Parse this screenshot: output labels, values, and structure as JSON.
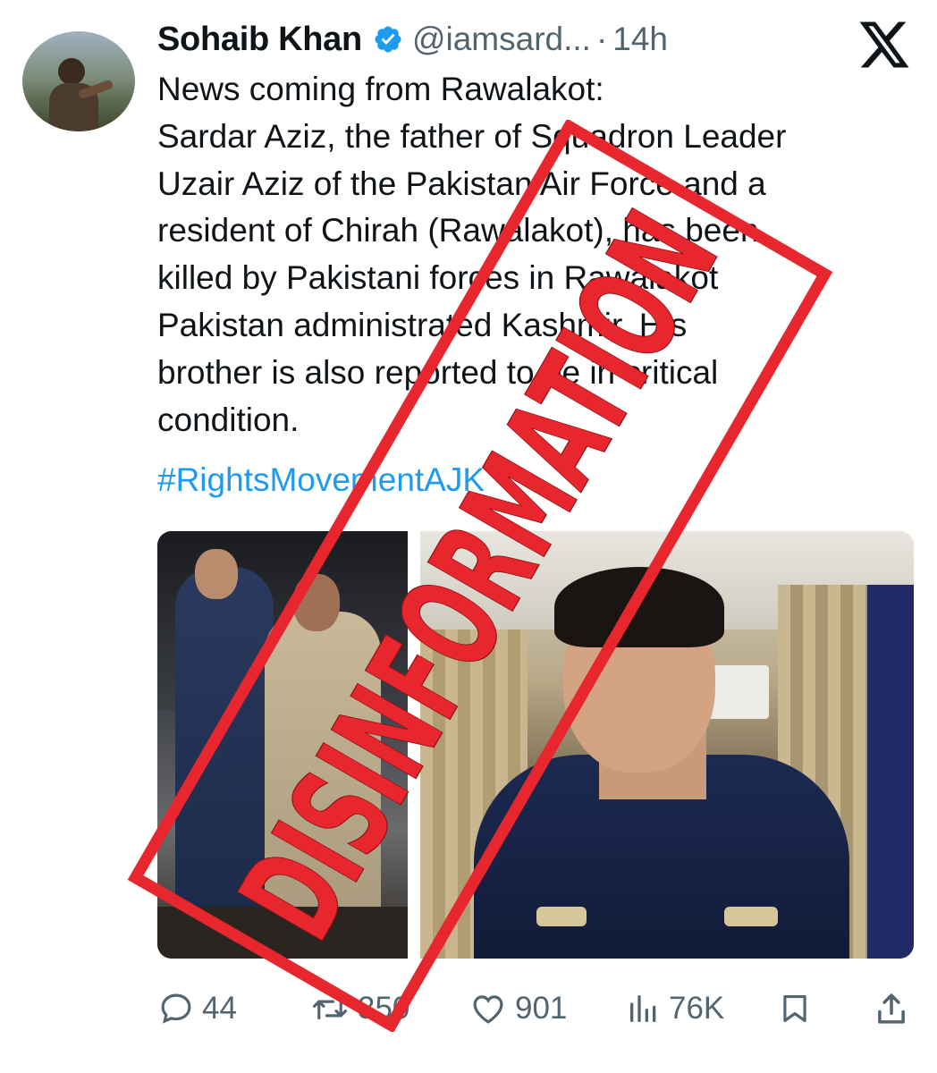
{
  "author": {
    "name": "Sohaib Khan",
    "handle": "@iamsard...",
    "separator": "·",
    "time": "14h"
  },
  "tweet": {
    "lines": [
      "News coming from Rawalakot:",
      "Sardar Aziz, the father of Squadron Leader",
      "Uzair Aziz of the Pakistan Air Force and a",
      "resident of Chirah (Rawalakot), has been",
      "killed by Pakistani forces in Rawalakot",
      "Pakistan administrated Kashmir. His",
      "brother is also reported to be in critical",
      "condition."
    ],
    "hashtag": "#RightsMovementAJK"
  },
  "stats": {
    "replies": "44",
    "reposts": "350",
    "likes": "901",
    "views": "76K"
  },
  "stamp": {
    "text": "DISINFORMATION",
    "color": "#e8262e"
  },
  "icons": {
    "verified": "verified-badge-icon",
    "platform": "x-logo-icon",
    "reply": "reply-icon",
    "repost": "repost-icon",
    "like": "heart-icon",
    "views": "views-chart-icon",
    "bookmark": "bookmark-icon",
    "share": "share-icon"
  },
  "colors": {
    "text": "#0f1419",
    "secondary": "#536471",
    "link": "#1d9bf0",
    "verified": "#1d9bf0"
  }
}
